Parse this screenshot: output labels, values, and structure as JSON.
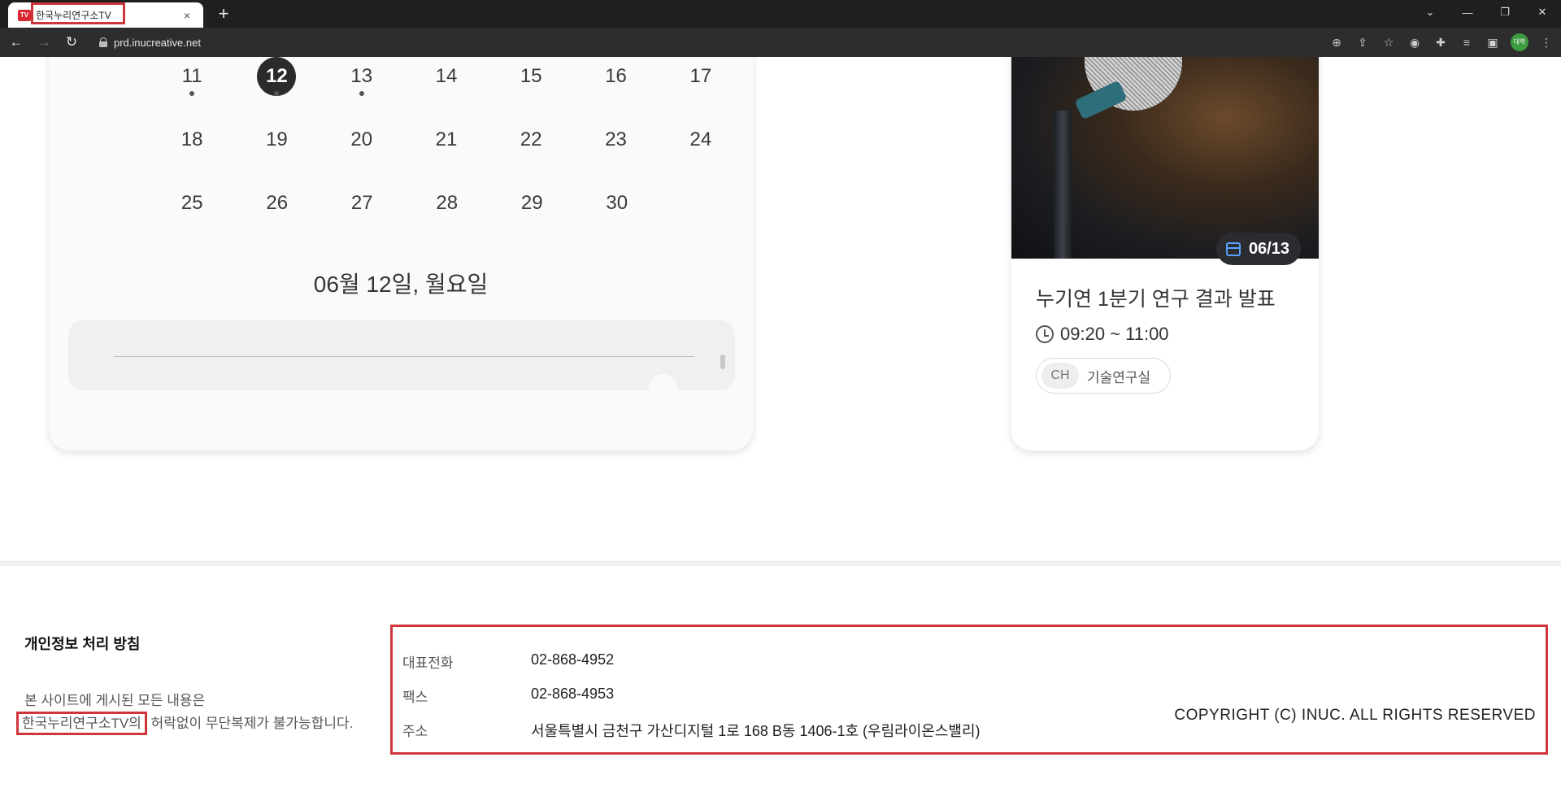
{
  "browser": {
    "tab_title": "한국누리연구소TV",
    "favicon_text": "TV",
    "close_glyph": "×",
    "new_tab_glyph": "+",
    "url": "prd.inucreative.net",
    "profile_label": "대학"
  },
  "calendar": {
    "weeks": [
      [
        {
          "day": "11",
          "dot": true
        },
        {
          "day": "12",
          "dot": true,
          "selected": true
        },
        {
          "day": "13",
          "dot": true
        },
        {
          "day": "14"
        },
        {
          "day": "15"
        },
        {
          "day": "16"
        },
        {
          "day": "17"
        }
      ],
      [
        {
          "day": "18"
        },
        {
          "day": "19"
        },
        {
          "day": "20"
        },
        {
          "day": "21"
        },
        {
          "day": "22"
        },
        {
          "day": "23"
        },
        {
          "day": "24"
        }
      ],
      [
        {
          "day": "25"
        },
        {
          "day": "26"
        },
        {
          "day": "27"
        },
        {
          "day": "28"
        },
        {
          "day": "29"
        },
        {
          "day": "30"
        }
      ]
    ],
    "selected_date_label": "06월 12일, 월요일"
  },
  "event": {
    "date_badge": "06/13",
    "title": "누기연 1분기 연구 결과 발표",
    "time": "09:20 ~ 11:00",
    "channel_badge": "CH",
    "channel_name": "기술연구실"
  },
  "footer": {
    "privacy_title": "개인정보 처리 방침",
    "note_line1": "본 사이트에 게시된 모든 내용은",
    "note_line2_highlight": "한국누리연구소TV의",
    "note_line2_rest": " 허락없이 무단복제가 불가능합니다.",
    "contacts": [
      {
        "label": "대표전화",
        "value": "02-868-4952"
      },
      {
        "label": "팩스",
        "value": "02-868-4953"
      },
      {
        "label": "주소",
        "value": "서울특별시 금천구 가산디지털 1로 168 B동 1406-1호 (우림라이온스밸리)"
      }
    ],
    "copyright": "COPYRIGHT (C) INUC. ALL RIGHTS RESERVED"
  },
  "colors": {
    "highlight_red": "#d0353c",
    "badge_dark": "#2a2c30",
    "calendar_icon_blue": "#5aa0ff"
  }
}
